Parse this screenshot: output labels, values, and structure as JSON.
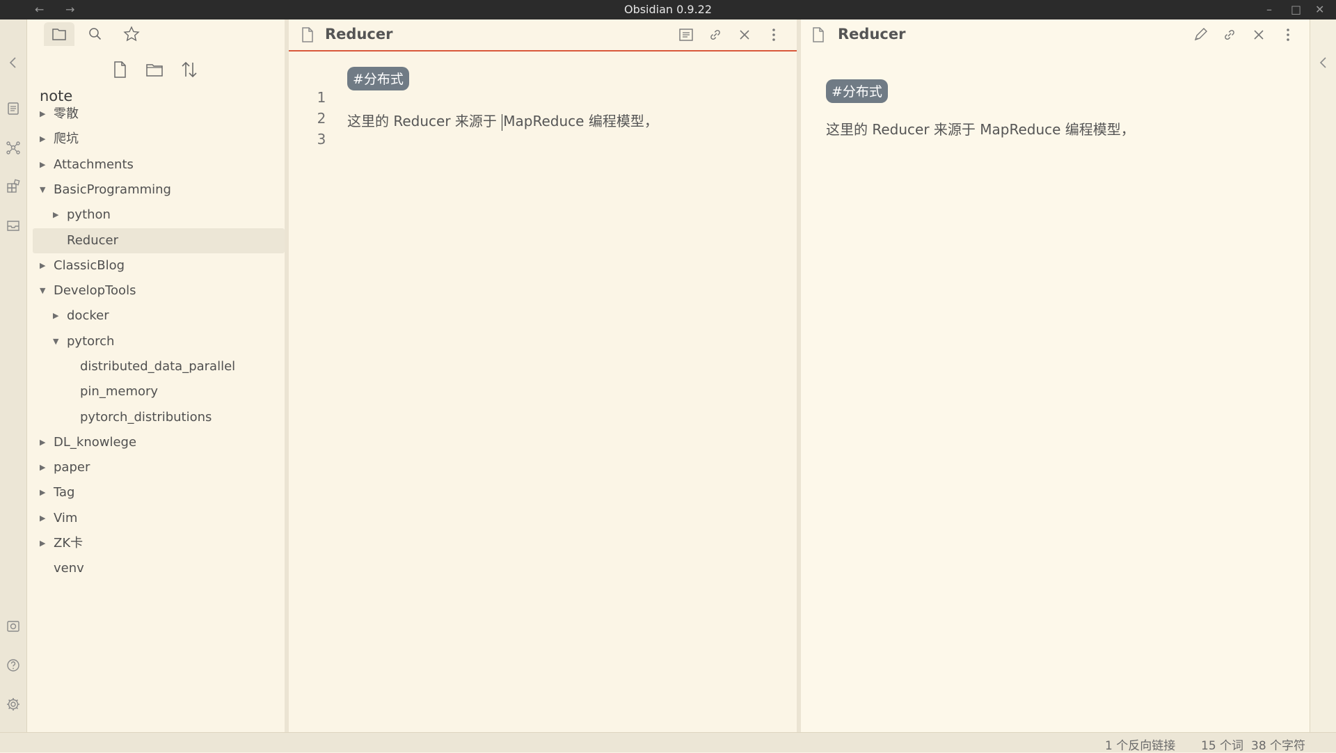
{
  "window": {
    "title": "Obsidian 0.9.22"
  },
  "explorer": {
    "vault_name": "note",
    "items": [
      {
        "label": "零散",
        "type": "folder",
        "expanded": false
      },
      {
        "label": "爬坑",
        "type": "folder",
        "expanded": false
      },
      {
        "label": "Attachments",
        "type": "folder",
        "expanded": false
      },
      {
        "label": "BasicProgramming",
        "type": "folder",
        "expanded": true
      },
      {
        "label": "python",
        "type": "folder",
        "expanded": false
      },
      {
        "label": "Reducer",
        "type": "file",
        "active": true
      },
      {
        "label": "ClassicBlog",
        "type": "folder",
        "expanded": false
      },
      {
        "label": "DevelopTools",
        "type": "folder",
        "expanded": true
      },
      {
        "label": "docker",
        "type": "folder",
        "expanded": false
      },
      {
        "label": "pytorch",
        "type": "folder",
        "expanded": true
      },
      {
        "label": "distributed_data_parallel",
        "type": "file"
      },
      {
        "label": "pin_memory",
        "type": "file"
      },
      {
        "label": "pytorch_distributions",
        "type": "file"
      },
      {
        "label": "DL_knowlege",
        "type": "folder",
        "expanded": false
      },
      {
        "label": "paper",
        "type": "folder",
        "expanded": false
      },
      {
        "label": "Tag",
        "type": "folder",
        "expanded": false
      },
      {
        "label": "Vim",
        "type": "folder",
        "expanded": false
      },
      {
        "label": "ZK卡",
        "type": "folder",
        "expanded": false
      },
      {
        "label": "venv",
        "type": "file"
      }
    ]
  },
  "editor": {
    "title": "Reducer",
    "lines": [
      {
        "num": "1",
        "tag": "#分布式"
      },
      {
        "num": "2"
      },
      {
        "num": "3",
        "text_before_cursor": "这里的 Reducer 来源于 ",
        "text_after_cursor": "MapReduce 编程模型，"
      }
    ]
  },
  "preview": {
    "title": "Reducer",
    "tag": "#分布式",
    "paragraph": "这里的 Reducer 来源于 MapReduce 编程模型，"
  },
  "status": {
    "backlinks": "1 个反向链接",
    "words": "15 个词",
    "chars": "38 个字符"
  },
  "colors": {
    "accent_underline": "#d9583b",
    "tag_bg": "#707b85",
    "background": "#fbf5e6"
  }
}
